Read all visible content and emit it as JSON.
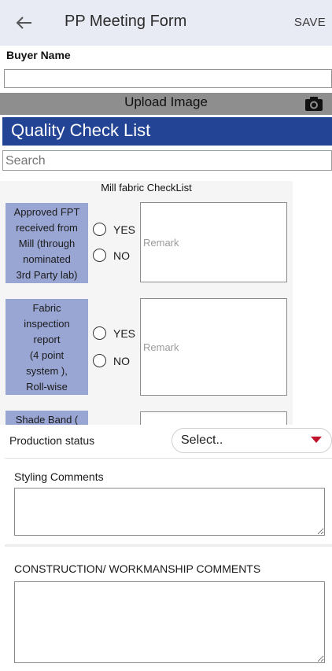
{
  "header": {
    "title": "PP Meeting Form",
    "save_label": "SAVE",
    "back_icon": "arrow-left-icon"
  },
  "buyer": {
    "label": "Buyer Name",
    "value": ""
  },
  "upload": {
    "label": "Upload Image",
    "icon": "camera-icon"
  },
  "quality": {
    "title": "Quality Check List",
    "accent": "#234394"
  },
  "search": {
    "placeholder": "Search"
  },
  "checklist": {
    "section_title": "Mill fabric CheckList",
    "label_bg": "#99a6d3",
    "items": [
      {
        "lines": [
          "Approved FPT",
          "received from",
          "Mill (through",
          "nominated",
          "3rd Party lab)"
        ],
        "yes_label": "YES",
        "no_label": "NO",
        "remark_placeholder": "Remark"
      },
      {
        "lines": [
          "Fabric",
          "inspection",
          "report",
          "(4 point",
          "system ),",
          "Roll-wise"
        ],
        "yes_label": "YES",
        "no_label": "NO",
        "remark_placeholder": "Remark"
      },
      {
        "lines": [
          "Shade Band ("
        ]
      }
    ]
  },
  "production": {
    "label": "Production status",
    "select_value": "Select..",
    "arrow_color": "#c1132c"
  },
  "styling": {
    "label": "Styling Comments",
    "value": ""
  },
  "construction": {
    "label": "CONSTRUCTION/ WORKMANSHIP COMMENTS",
    "value": ""
  }
}
